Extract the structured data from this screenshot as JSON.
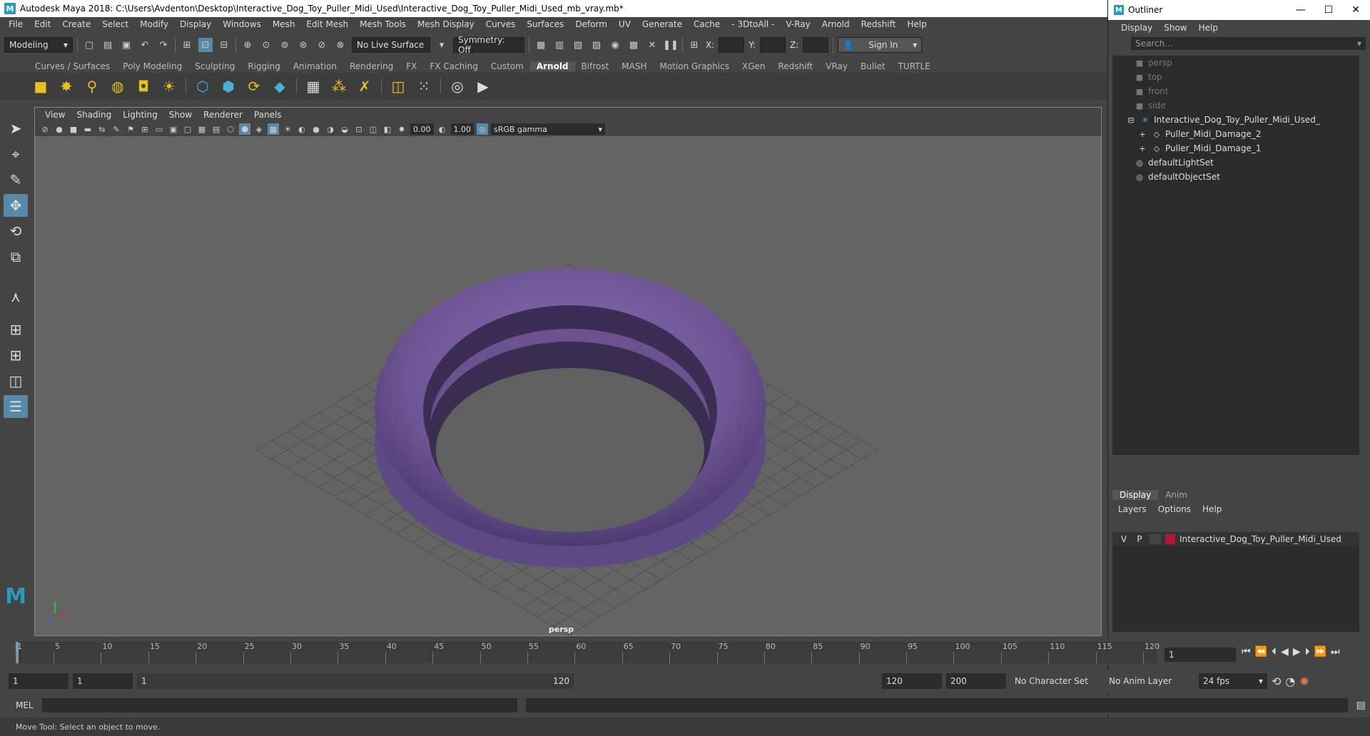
{
  "window": {
    "title": "Autodesk Maya 2018: C:\\Users\\Avdenton\\Desktop\\Interactive_Dog_Toy_Puller_Midi_Used\\Interactive_Dog_Toy_Puller_Midi_Used_mb_vray.mb*"
  },
  "menubar": [
    "File",
    "Edit",
    "Create",
    "Select",
    "Modify",
    "Display",
    "Windows",
    "Mesh",
    "Edit Mesh",
    "Mesh Tools",
    "Mesh Display",
    "Curves",
    "Surfaces",
    "Deform",
    "UV",
    "Generate",
    "Cache",
    "- 3DtoAll -",
    "V-Ray",
    "Arnold",
    "Redshift",
    "Help"
  ],
  "statusline": {
    "mode": "Modeling",
    "live_surface": "No Live Surface",
    "symmetry": "Symmetry: Off",
    "x_label": "X:",
    "y_label": "Y:",
    "z_label": "Z:",
    "sign_in": "Sign In"
  },
  "shelf_tabs": [
    "Curves / Surfaces",
    "Poly Modeling",
    "Sculpting",
    "Rigging",
    "Animation",
    "Rendering",
    "FX",
    "FX Caching",
    "Custom",
    "Arnold",
    "Bifrost",
    "MASH",
    "Motion Graphics",
    "XGen",
    "Redshift",
    "VRay",
    "Bullet",
    "TURTLE"
  ],
  "shelf_active": "Arnold",
  "viewport": {
    "menu": [
      "View",
      "Shading",
      "Lighting",
      "Show",
      "Renderer",
      "Panels"
    ],
    "exposure": "0.00",
    "gamma": "1.00",
    "colorspace": "sRGB gamma",
    "camera_label": "persp"
  },
  "outliner": {
    "title": "Outliner",
    "menu": [
      "Display",
      "Show",
      "Help"
    ],
    "search_placeholder": "Search...",
    "items": [
      {
        "label": "persp",
        "dim": true
      },
      {
        "label": "top",
        "dim": true
      },
      {
        "label": "front",
        "dim": true
      },
      {
        "label": "side",
        "dim": true
      },
      {
        "label": "Interactive_Dog_Toy_Puller_Midi_Used_",
        "dim": false
      },
      {
        "label": "Puller_Midi_Damage_2",
        "dim": false
      },
      {
        "label": "Puller_Midi_Damage_1",
        "dim": false
      },
      {
        "label": "defaultLightSet",
        "dim": false
      },
      {
        "label": "defaultObjectSet",
        "dim": false
      }
    ]
  },
  "layer_editor": {
    "tabs": [
      "Display",
      "Anim"
    ],
    "menu": [
      "Layers",
      "Options",
      "Help"
    ],
    "layer": {
      "v": "V",
      "p": "P",
      "name": "Interactive_Dog_Toy_Puller_Midi_Used",
      "color": "#b0173a"
    }
  },
  "timeline": {
    "ticks": [
      "1",
      "5",
      "10",
      "15",
      "20",
      "25",
      "30",
      "35",
      "40",
      "45",
      "50",
      "55",
      "60",
      "65",
      "70",
      "75",
      "80",
      "85",
      "90",
      "95",
      "100",
      "105",
      "110",
      "115",
      "120"
    ],
    "current_frame": "1"
  },
  "range": {
    "start": "1",
    "playback_start": "1",
    "slider_start": "1",
    "slider_end": "120",
    "playback_end": "120",
    "end": "200",
    "character_set": "No Character Set",
    "anim_layer": "No Anim Layer",
    "fps": "24 fps"
  },
  "command_line": {
    "label": "MEL"
  },
  "help_line": "Move Tool: Select an object to move."
}
